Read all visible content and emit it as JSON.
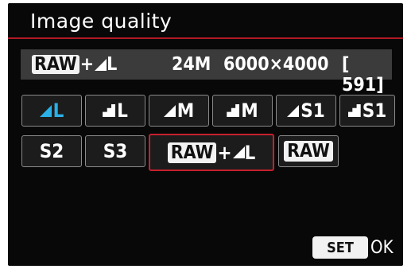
{
  "header": {
    "title": "Image quality"
  },
  "status_bar": {
    "raw_label": "RAW",
    "plus": "+",
    "size_letter": "L",
    "megapixels": "24M",
    "resolution": "6000×4000",
    "shots_remaining": "[ 591]"
  },
  "options": [
    {
      "id": "fine-l",
      "icon": "fine-triangle-icon",
      "label": "L",
      "state": "current"
    },
    {
      "id": "normal-l",
      "icon": "normal-stair-icon",
      "label": "L"
    },
    {
      "id": "fine-m",
      "icon": "fine-triangle-icon",
      "label": "M"
    },
    {
      "id": "normal-m",
      "icon": "normal-stair-icon",
      "label": "M"
    },
    {
      "id": "fine-s1",
      "icon": "fine-triangle-icon",
      "label": "S1"
    },
    {
      "id": "normal-s1",
      "icon": "normal-stair-icon",
      "label": "S1"
    },
    {
      "id": "s2",
      "label": "S2"
    },
    {
      "id": "s3",
      "label": "S3"
    },
    {
      "id": "raw-plus-l",
      "raw_label": "RAW",
      "plus": "+",
      "icon": "fine-triangle-icon",
      "label": "L",
      "state": "selected"
    },
    {
      "id": "raw",
      "raw_label": "RAW"
    }
  ],
  "footer": {
    "set_label": "SET",
    "ok_label": "OK"
  },
  "colors": {
    "accent_blue": "#2ab0e6",
    "selection_red": "#c5202d",
    "title_rule": "#b01a24"
  }
}
